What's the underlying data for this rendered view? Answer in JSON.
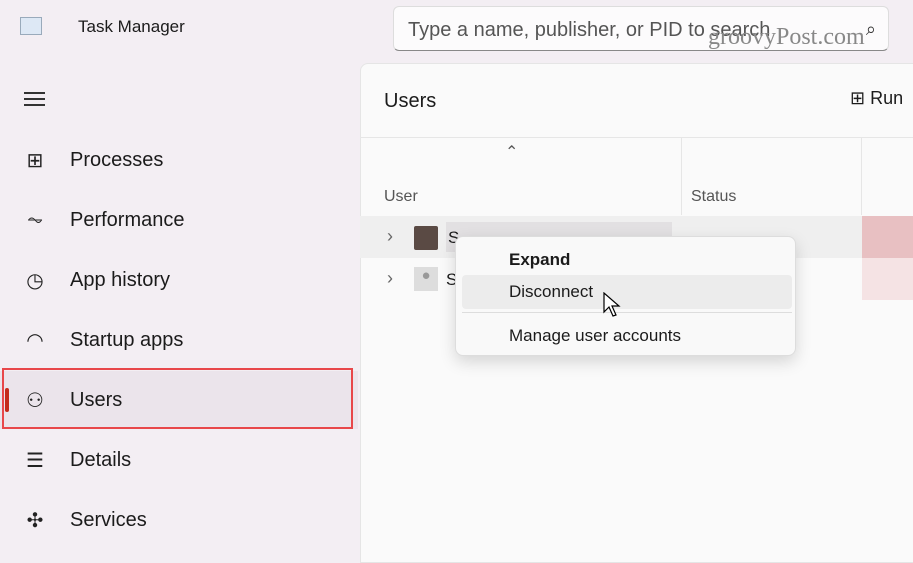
{
  "app": {
    "title": "Task Manager",
    "icon": "performance-graph-icon"
  },
  "search": {
    "placeholder": "Type a name, publisher, or PID to search"
  },
  "watermark": "groovyPost.com",
  "sidebar": {
    "items": [
      {
        "label": "Processes",
        "icon": "processes-grid-icon"
      },
      {
        "label": "Performance",
        "icon": "pulse-icon"
      },
      {
        "label": "App history",
        "icon": "history-icon"
      },
      {
        "label": "Startup apps",
        "icon": "speedometer-icon"
      },
      {
        "label": "Users",
        "icon": "users-icon",
        "active": true
      },
      {
        "label": "Details",
        "icon": "list-icon"
      },
      {
        "label": "Services",
        "icon": "puzzle-icon"
      }
    ]
  },
  "main": {
    "title": "Users",
    "run_label": "Run",
    "columns": [
      "User",
      "Status"
    ],
    "rows": [
      {
        "name": "S",
        "avatar": "photo"
      },
      {
        "name": "S",
        "avatar": "default"
      }
    ]
  },
  "context_menu": {
    "items": [
      "Expand",
      "Disconnect",
      "Manage user accounts"
    ]
  },
  "colors": {
    "accent": "#c42b1c",
    "highlight_box": "#e8474a",
    "cpu_heat": "#e8c0c2"
  }
}
